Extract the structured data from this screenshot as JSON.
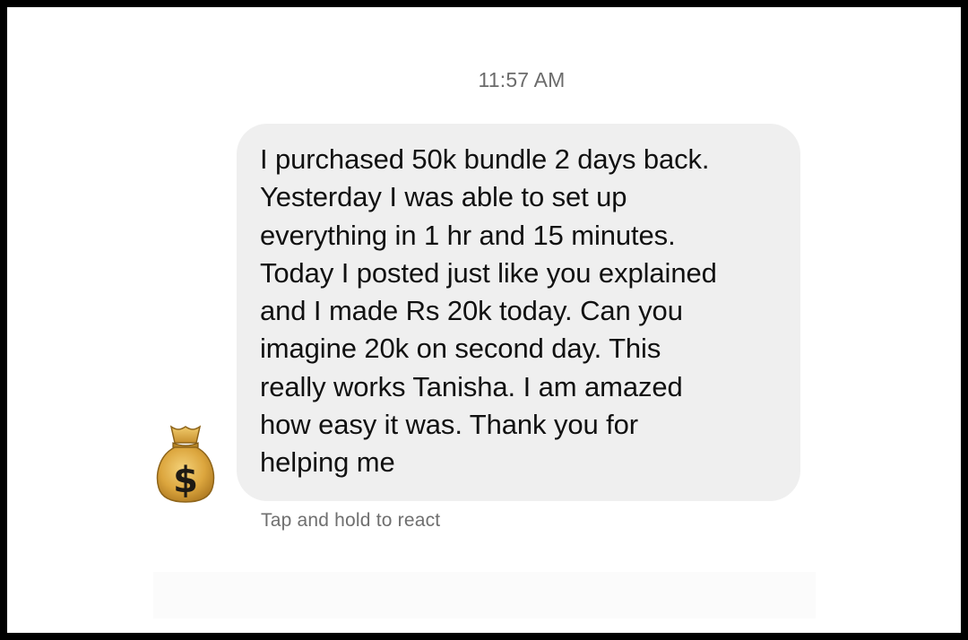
{
  "chat": {
    "timestamp": "11:57 AM",
    "message_lines": [
      "I purchased 50k bundle 2 days back.",
      "Yesterday I was able to set up",
      "everything in 1 hr and 15 minutes.",
      "Today I posted just like you explained",
      "and I made Rs 20k today. Can you",
      "imagine 20k on second day. This",
      "really works Tanisha. I am amazed",
      "how easy it was. Thank you for",
      "helping me"
    ],
    "sender_avatar_icon": "money-bag-icon",
    "react_hint": "Tap and hold to react"
  },
  "colors": {
    "bubble": "#efefef",
    "timestamp_text": "#6b6b6b",
    "hint_text": "#6f6f6f",
    "message_text": "#111111",
    "frame_border": "#000000"
  }
}
